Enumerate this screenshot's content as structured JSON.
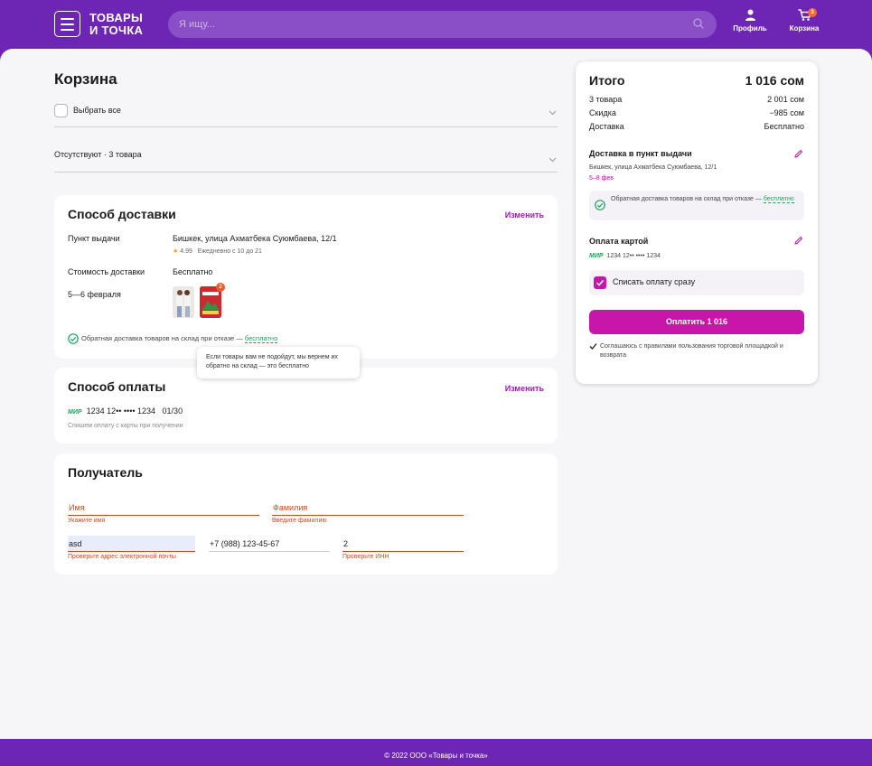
{
  "header": {
    "logo_line1": "ТОВАРЫ",
    "logo_line2": "И ТОЧКА",
    "search_placeholder": "Я ищу...",
    "profile_label": "Профиль",
    "cart_label": "Корзина",
    "cart_count": "3"
  },
  "cart": {
    "title": "Корзина",
    "select_all": "Выбрать все",
    "absent": "Отсутствуют · 3 товара"
  },
  "delivery": {
    "title": "Способ доставки",
    "change": "Изменить",
    "pickup_label": "Пункт выдачи",
    "pickup_address": "Бишкек, улица Ахматбека Суюмбаева, 12/1",
    "rating": "4.99",
    "hours": "Ежедневно с 10 до 21",
    "cost_label": "Стоимость доставки",
    "cost_value": "Бесплатно",
    "date": "5—6 февраля",
    "thumb_badge": "2",
    "return_text": "Обратная доставка товаров на склад при отказе —",
    "return_link": "бесплатно",
    "tooltip": "Если товары вам не подойдут, мы вернем их обратно на склад — это бесплатно"
  },
  "payment": {
    "title": "Способ оплаты",
    "change": "Изменить",
    "card_brand": "МИР",
    "card_number": "1234 12•• •••• 1234",
    "card_expiry": "01/30",
    "note": "Спишем оплату с карты при получении"
  },
  "recipient": {
    "title": "Получатель",
    "name_placeholder": "Имя",
    "name_error": "Укажите имя",
    "surname_placeholder": "Фамилия",
    "surname_error": "Введите фамилию",
    "email_value": "asd",
    "email_error": "Проверьте адрес электронной почты",
    "phone_value": "+7 (988) 123-45-67",
    "inn_value": "2",
    "inn_error": "Проверьте ИНН"
  },
  "summary": {
    "title": "Итого",
    "total": "1 016 сом",
    "items_label": "3 товара",
    "items_value": "2 001 сом",
    "discount_label": "Скидка",
    "discount_value": "−985 сом",
    "delivery_label": "Доставка",
    "delivery_value": "Бесплатно",
    "pickup_title": "Доставка в пункт выдачи",
    "pickup_address": "Бишкек, улица Ахматбека Суюмбаева, 12/1",
    "pickup_dates": "5–8 фев",
    "return_text": "Обратная доставка товаров на склад при отказе —",
    "return_link": "бесплатно",
    "card_title": "Оплата картой",
    "card_brand": "МИР",
    "card_number": "1234 12•• •••• 1234",
    "pay_now": "Списать оплату сразу",
    "pay_button": "Оплатить 1 016",
    "agree": "Соглашаюсь с правилами пользования торговой площадкой и возврата"
  },
  "footer": {
    "copyright": "© 2022 ООО «Товары и точка»"
  },
  "colors": {
    "brand": "#6d26b3",
    "accent": "#c916aa",
    "success": "#1ba45a",
    "error": "#d04a1e"
  }
}
